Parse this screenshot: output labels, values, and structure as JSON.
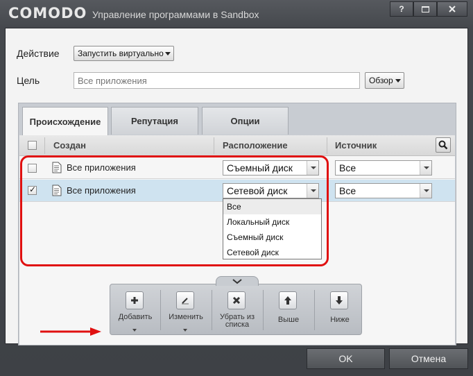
{
  "window": {
    "logo": "COMODO",
    "title": "Управление программами в Sandbox",
    "help_label": "?"
  },
  "form": {
    "action_label": "Действие",
    "action_value": "Запустить виртуально",
    "target_label": "Цель",
    "target_placeholder": "Все приложения",
    "browse_label": "Обзор"
  },
  "tabs": [
    {
      "label": "Происхождение"
    },
    {
      "label": "Репутация"
    },
    {
      "label": "Опции"
    }
  ],
  "table": {
    "columns": [
      "Создан",
      "Расположение",
      "Источник"
    ],
    "rows": [
      {
        "checked": false,
        "created": "Все приложения",
        "location": "Съемный диск",
        "source": "Все"
      },
      {
        "checked": true,
        "created": "Все приложения",
        "location": "Сетевой диск",
        "source": "Все"
      }
    ]
  },
  "location_dropdown": {
    "options": [
      "Все",
      "Локальный диск",
      "Съемный диск",
      "Сетевой диск"
    ]
  },
  "toolbar": {
    "items": [
      {
        "label": "Добавить"
      },
      {
        "label": "Изменить"
      },
      {
        "label": "Убрать из\nсписка"
      },
      {
        "label": "Выше"
      },
      {
        "label": "Ниже"
      }
    ]
  },
  "buttons": {
    "ok": "OK",
    "cancel": "Отмена"
  }
}
